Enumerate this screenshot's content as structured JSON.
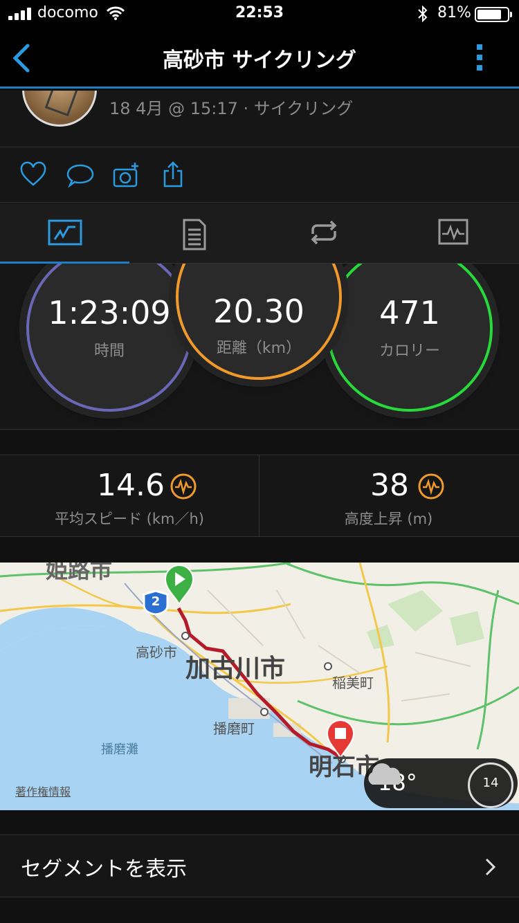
{
  "status_bar": {
    "carrier": "docomo",
    "time": "22:53",
    "battery_percent": "81%",
    "battery_level": 0.81
  },
  "nav": {
    "title": "高砂市 サイクリング"
  },
  "header": {
    "date_line": "18 4月 @ 15:17 · サイクリング"
  },
  "actions": {
    "icons": [
      "heart-icon",
      "comment-icon",
      "add-photo-icon",
      "share-icon"
    ]
  },
  "tabs": {
    "icons": [
      "overview-chart-icon",
      "details-document-icon",
      "laps-loop-icon",
      "graph-icon"
    ],
    "active_index": 0
  },
  "summary": {
    "time": {
      "value": "1:23:09",
      "label": "時間",
      "color": "#6a67b6"
    },
    "distance": {
      "value": "20.30",
      "label": "距離（km）",
      "color": "#f09a2c"
    },
    "calories": {
      "value": "471",
      "label": "カロリー",
      "color": "#27d93a"
    }
  },
  "stats": {
    "avg_speed": {
      "value": "14.6",
      "label": "平均スピード (km／h)"
    },
    "elevation_gain": {
      "value": "38",
      "label": "高度上昇 (m)"
    }
  },
  "map": {
    "labels": {
      "himeji": "姫路市",
      "takasago": "高砂市",
      "kakogawa": "加古川市",
      "inami": "稲美町",
      "harima": "播磨町",
      "harimanada": "播磨灘",
      "akashi": "明石市"
    },
    "route_shield": "2",
    "copyright": "著作権情報",
    "weather": {
      "temperature": "18°",
      "wind": "14"
    }
  },
  "segments": {
    "label": "セグメントを表示"
  },
  "colors": {
    "accent": "#1f7fc4",
    "pulse": "#f09a2c",
    "route": "#b51a2a",
    "start": "#3cb043",
    "finish": "#e53935"
  }
}
